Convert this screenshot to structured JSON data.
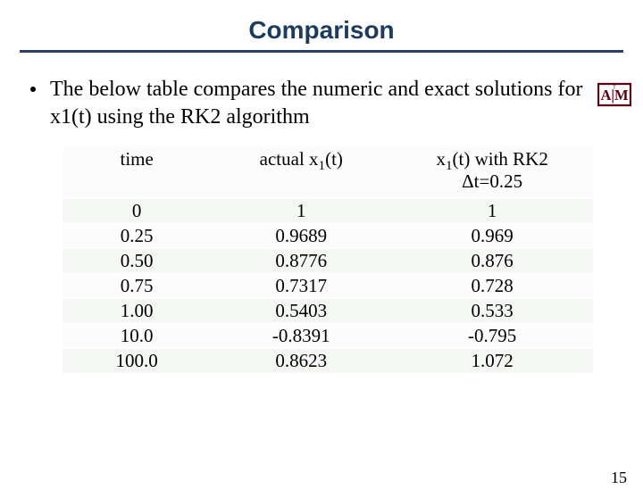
{
  "title": "Comparison",
  "bullet": "The below table compares the numeric and exact solutions for x1(t) using the RK2 algorithm",
  "table": {
    "head": {
      "c1": "time",
      "c2_pre": "actual x",
      "c2_sub": "1",
      "c2_post": "(t)",
      "c3_pre": "x",
      "c3_sub": "1",
      "c3_mid": "(t) with RK2",
      "c3_line2": "Δt=0.25"
    },
    "rows": [
      {
        "t": "0",
        "a": "1",
        "r": "1"
      },
      {
        "t": "0.25",
        "a": "0.9689",
        "r": "0.969"
      },
      {
        "t": "0.50",
        "a": "0.8776",
        "r": "0.876"
      },
      {
        "t": "0.75",
        "a": "0.7317",
        "r": "0.728"
      },
      {
        "t": "1.00",
        "a": "0.5403",
        "r": "0.533"
      },
      {
        "t": "10.0",
        "a": "-0.8391",
        "r": "-0.795"
      },
      {
        "t": "100.0",
        "a": "0.8623",
        "r": "1.072"
      }
    ]
  },
  "page_number": "15",
  "chart_data": {
    "type": "table",
    "title": "Comparison",
    "columns": [
      "time",
      "actual x1(t)",
      "x1(t) with RK2 Δt=0.25"
    ],
    "rows": [
      [
        0,
        1,
        1
      ],
      [
        0.25,
        0.9689,
        0.969
      ],
      [
        0.5,
        0.8776,
        0.876
      ],
      [
        0.75,
        0.7317,
        0.728
      ],
      [
        1.0,
        0.5403,
        0.533
      ],
      [
        10.0,
        -0.8391,
        -0.795
      ],
      [
        100.0,
        0.8623,
        1.072
      ]
    ]
  }
}
